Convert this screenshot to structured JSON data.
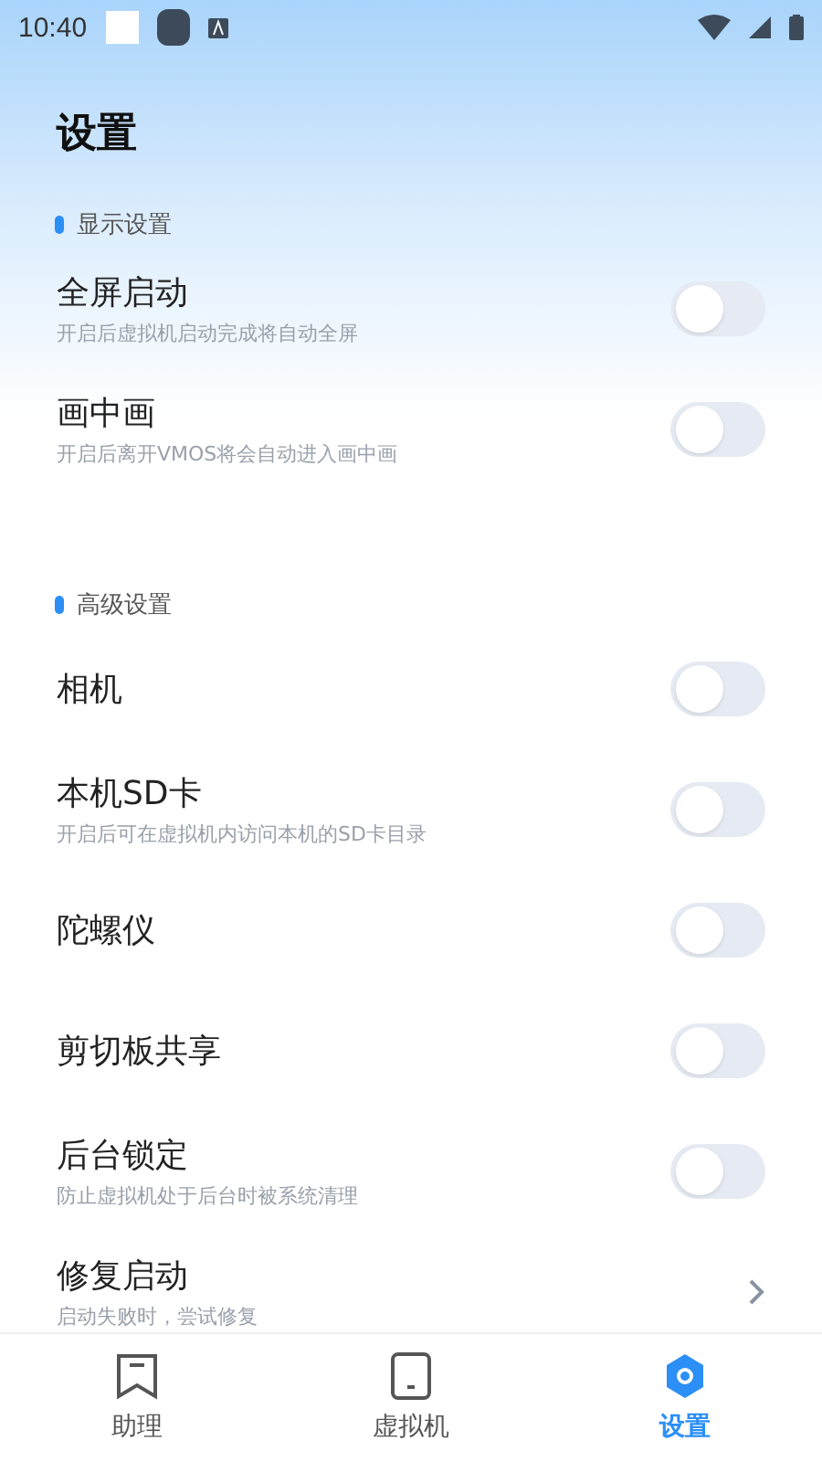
{
  "status_bar": {
    "time": "10:40"
  },
  "title": "设置",
  "sections": [
    {
      "label": "显示设置",
      "items": [
        {
          "kind": "toggle",
          "title": "全屏启动",
          "subtitle": "开启后虚拟机启动完成将自动全屏",
          "on": false
        },
        {
          "kind": "toggle",
          "title": "画中画",
          "subtitle": "开启后离开VMOS将会自动进入画中画",
          "on": false
        }
      ]
    },
    {
      "label": "高级设置",
      "items": [
        {
          "kind": "toggle",
          "title": "相机",
          "on": false
        },
        {
          "kind": "toggle",
          "title": "本机SD卡",
          "subtitle": "开启后可在虚拟机内访问本机的SD卡目录",
          "on": false
        },
        {
          "kind": "toggle",
          "title": "陀螺仪",
          "on": false
        },
        {
          "kind": "toggle",
          "title": "剪切板共享",
          "on": false
        },
        {
          "kind": "toggle",
          "title": "后台锁定",
          "subtitle": "防止虚拟机处于后台时被系统清理",
          "on": false
        },
        {
          "kind": "link",
          "title": "修复启动",
          "subtitle": "启动失败时，尝试修复"
        }
      ]
    }
  ],
  "nav": [
    {
      "label": "助理",
      "selected": false
    },
    {
      "label": "虚拟机",
      "selected": false
    },
    {
      "label": "设置",
      "selected": true
    }
  ]
}
